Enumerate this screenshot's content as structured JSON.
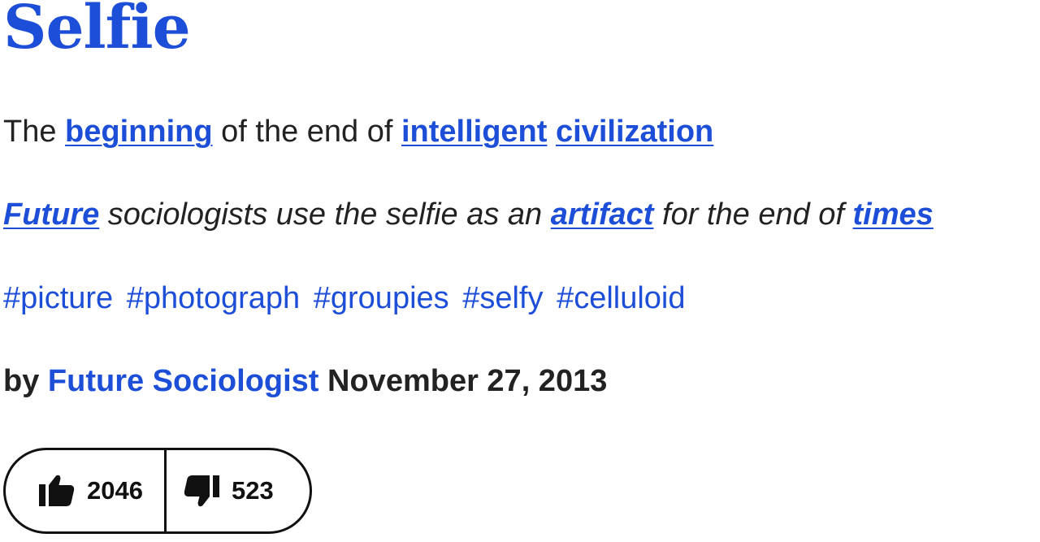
{
  "definition": {
    "word": "Selfie",
    "meaning": {
      "prefix": "The ",
      "link1": "beginning",
      "middle": " of the end of ",
      "link2": "intelligent",
      "space": " ",
      "link3": "civilization"
    },
    "example": {
      "link1": "Future",
      "text1": " sociologists use the selfie as an ",
      "link2": "artifact",
      "text2": " for the end of ",
      "link3": "times"
    },
    "tags": [
      "#picture",
      "#photograph",
      "#groupies",
      "#selfy",
      "#celluloid"
    ],
    "contributor": {
      "by_label": "by ",
      "author": "Future Sociologist",
      "date": " November 27, 2013"
    },
    "votes": {
      "up_icon": "thumbs-up-icon",
      "up_count": "2046",
      "down_icon": "thumbs-down-icon",
      "down_count": "523"
    }
  },
  "colors": {
    "link": "#1d4ed8",
    "text": "#222222",
    "border": "#111111"
  }
}
